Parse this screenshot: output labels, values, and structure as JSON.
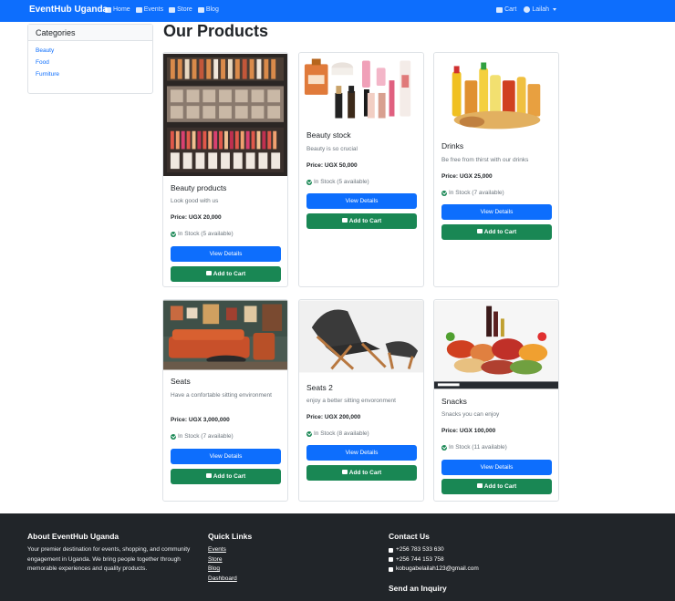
{
  "navbar": {
    "brand": "EventHub Uganda",
    "links": [
      {
        "label": "Home",
        "icon": "home-icon"
      },
      {
        "label": "Events",
        "icon": "calendar-icon"
      },
      {
        "label": "Store",
        "icon": "store-icon"
      },
      {
        "label": "Blog",
        "icon": "newspaper-icon"
      }
    ],
    "cart_label": "Cart",
    "user_label": "Lailah"
  },
  "sidebar": {
    "title": "Categories",
    "items": [
      "Beauty",
      "Food",
      "Furniture"
    ]
  },
  "page_title": "Our Products",
  "buttons": {
    "view_details": "View Details",
    "add_to_cart": "Add to Cart"
  },
  "products": [
    {
      "name": "Beauty products",
      "desc": "Look good with us",
      "price": "Price: UGX 20,000",
      "stock": "In Stock (5 available)"
    },
    {
      "name": "Beauty stock",
      "desc": "Beauty is so crucial",
      "price": "Price: UGX 50,000",
      "stock": "In Stock (5 available)"
    },
    {
      "name": "Drinks",
      "desc": "Be free from thirst with our drinks",
      "price": "Price: UGX 25,000",
      "stock": "In Stock (7 available)"
    },
    {
      "name": "Seats",
      "desc": "Have a confortable sitting environment",
      "price": "Price: UGX 3,000,000",
      "stock": "In Stock (7 available)"
    },
    {
      "name": "Seats 2",
      "desc": "enjoy a better sitting envoronment",
      "price": "Price: UGX 200,000",
      "stock": "In Stock (8 available)"
    },
    {
      "name": "Snacks",
      "desc": "Snacks you can enjoy",
      "price": "Price: UGX 100,000",
      "stock": "In Stock (11 available)"
    }
  ],
  "footer": {
    "about_title": "About EventHub Uganda",
    "about_text": "Your premier destination for events, shopping, and community engagement in Uganda. We bring people together through memorable experiences and quality products.",
    "links_title": "Quick Links",
    "links": [
      "Events",
      "Store",
      "Blog",
      "Dashboard"
    ],
    "contact_title": "Contact Us",
    "phone1": "+256 783 533 630",
    "phone2": "+256 744 153 758",
    "email": "kobugabelailah123@gmail.com",
    "inquiry_title": "Send an Inquiry"
  }
}
